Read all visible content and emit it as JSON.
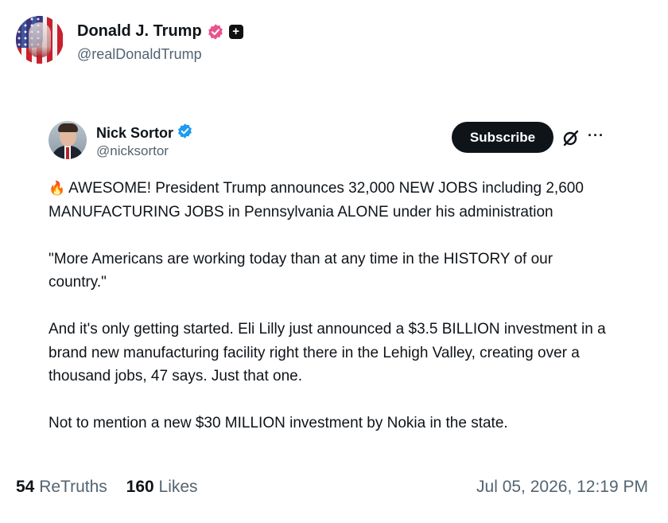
{
  "post": {
    "author_name": "Donald J. Trump",
    "author_handle": "@realDonaldTrump",
    "pink_badge_icon": "verified-badge-icon",
    "pink_badge_color": "#e8538f",
    "plus_badge": "+"
  },
  "quote": {
    "author_name": "Nick Sortor",
    "author_handle": "@nicksortor",
    "verified_color": "#1d9bf0",
    "subscribe_label": "Subscribe",
    "more_label": "···",
    "fire_emoji": "🔥",
    "paragraphs": [
      "AWESOME! President Trump announces 32,000 NEW JOBS including 2,600 MANUFACTURING JOBS in Pennsylvania ALONE under his administration",
      "\"More Americans are working today than at any time in the HISTORY of our country.\"",
      "And it's only getting started. Eli Lilly just announced a $3.5 BILLION investment in a brand new manufacturing facility right there in the Lehigh Valley, creating over a thousand jobs, 47 says. Just that one.",
      "Not to mention a new $30 MILLION investment by Nokia in the state."
    ]
  },
  "stats": {
    "retruths_count": "54",
    "retruths_label": "ReTruths",
    "likes_count": "160",
    "likes_label": "Likes",
    "timestamp": "Jul 05, 2026, 12:19 PM"
  }
}
